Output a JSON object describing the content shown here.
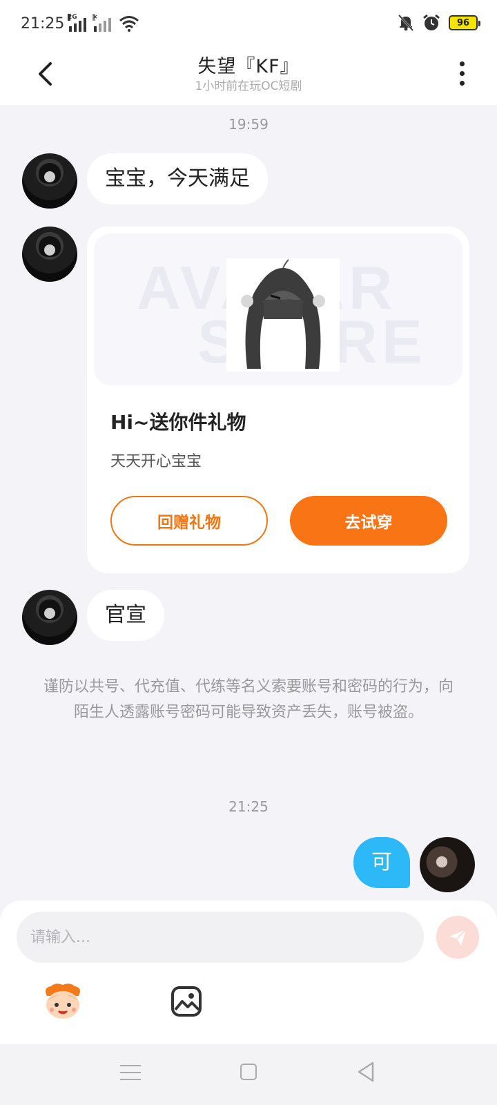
{
  "status_bar": {
    "time": "21:25",
    "sim1_tag": "2G",
    "sim2_tag": "×",
    "battery": "96"
  },
  "header": {
    "title": "失望『KF』",
    "subtitle": "1小时前在玩OC短剧"
  },
  "messages": {
    "timestamp_1": "19:59",
    "bubble_1": "宝宝，今天满足",
    "gift_card": {
      "watermark_1": "AVATAR",
      "watermark_2": "STORE",
      "title": "Hi~送你件礼物",
      "description": "天天开心宝宝",
      "return_gift_label": "回赠礼物",
      "try_on_label": "去试穿"
    },
    "bubble_2": "官宣",
    "notice": "谨防以共号、代充值、代练等名义索要账号和密码的行为，向陌生人透露账号密码可能导致资产丢失，账号被盗。",
    "timestamp_2": "21:25",
    "my_bubble": "可"
  },
  "input": {
    "placeholder": "请输入..."
  },
  "colors": {
    "accent": "#f97414",
    "my_bubble": "#2db8f7",
    "background": "#f3f3f8"
  },
  "icons": [
    "back-icon",
    "more-icon",
    "send-icon",
    "emoji-icon",
    "image-icon",
    "menu-icon",
    "home-icon",
    "nav-back-icon"
  ]
}
